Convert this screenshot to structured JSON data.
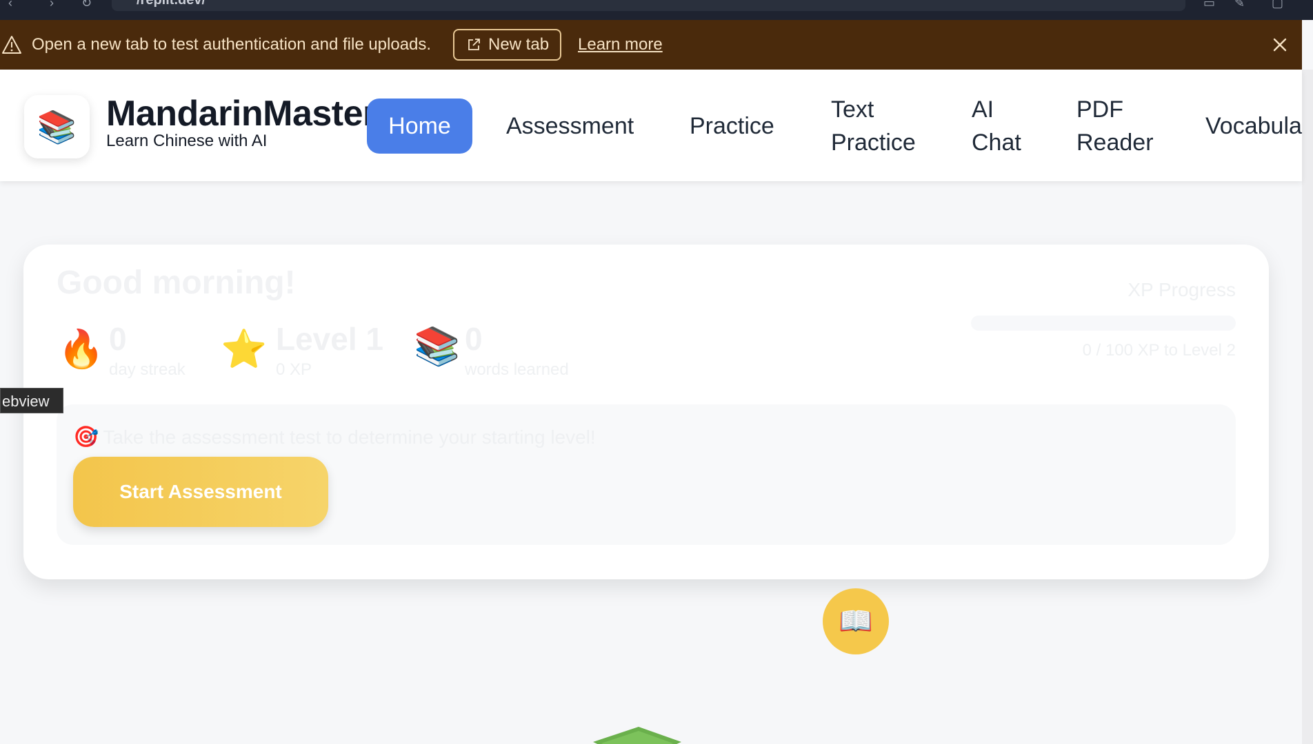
{
  "browser": {
    "url_text": "/replit.dev/"
  },
  "banner": {
    "message": "Open a new tab to test authentication and file uploads.",
    "new_tab_label": "New tab",
    "learn_more_label": "Learn more"
  },
  "header": {
    "logo_emoji": "📚",
    "brand_title": "MandarinMaster",
    "brand_subtitle": "Learn Chinese with AI",
    "nav": {
      "home": "Home",
      "assessment": "Assessment",
      "practice": "Practice",
      "text_practice_1": "Text",
      "text_practice_2": "Practice",
      "ai_chat_1": "AI",
      "ai_chat_2": "Chat",
      "pdf_reader_1": "PDF",
      "pdf_reader_2": "Reader",
      "vocabulary": "Vocabula"
    }
  },
  "dashboard": {
    "greeting": "Good morning!",
    "stats": {
      "streak_emoji": "🔥",
      "streak_value": "0",
      "streak_label": "day streak",
      "level_emoji": "⭐",
      "level_value": "Level 1",
      "level_label": "0 XP",
      "words_emoji": "📚",
      "words_value": "0",
      "words_label": "words learned"
    },
    "xp": {
      "title": "XP Progress",
      "caption": "0 / 100 XP to Level 2",
      "progress": 0
    },
    "assessment": {
      "emoji": "🎯",
      "text": "Take the assessment test to determine your starting level!",
      "button_label": "Start Assessment"
    }
  },
  "tooltip": {
    "label": "ebview"
  },
  "fab": {
    "emoji": "📖"
  },
  "colors": {
    "accent_blue": "#4a7ee8",
    "accent_yellow": "#f5c84b",
    "banner_bg": "#4a2a0c"
  }
}
